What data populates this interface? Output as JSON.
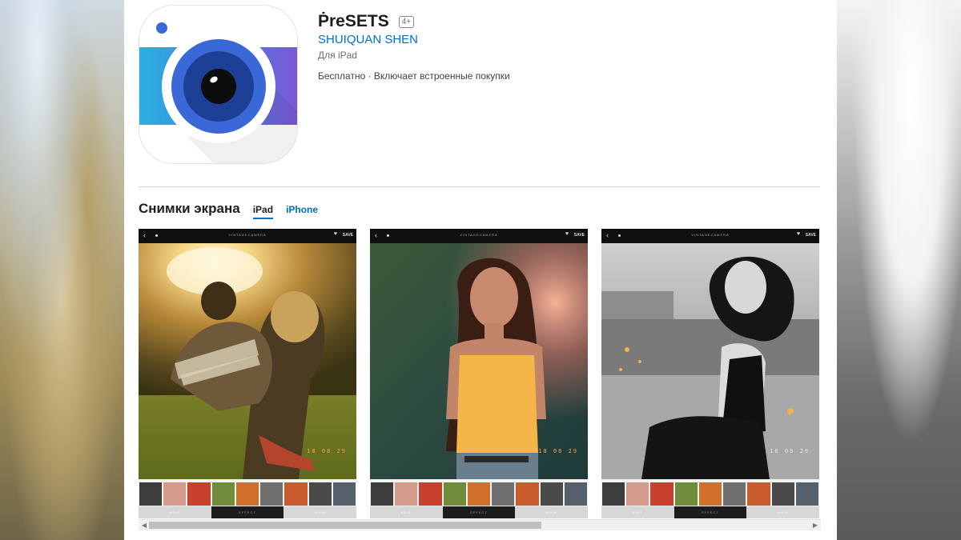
{
  "app": {
    "name": "ṖreSETS",
    "age_rating": "4+",
    "developer": "SHUIQUAN SHEN",
    "platform": "Для iPad",
    "price_line": "Бесплатно · Включает встроенные покупки"
  },
  "screenshots_section": {
    "title": "Снимки экрана",
    "tabs": [
      {
        "label": "iPad",
        "active": true
      },
      {
        "label": "iPhone",
        "active": false
      }
    ]
  },
  "screenshots": [
    {
      "back": "‹",
      "brand": "VINTAGECAMERA",
      "heart": "♥",
      "save": "SAVE",
      "date": "18 08 29",
      "bottom_tabs": [
        "EDIT",
        "EFFECT",
        "VIEW"
      ]
    },
    {
      "back": "‹",
      "brand": "VINTAGECAMERA",
      "heart": "♥",
      "save": "SAVE",
      "date": "18 08 29",
      "bottom_tabs": [
        "EDIT",
        "EFFECT",
        "VIEW"
      ]
    },
    {
      "back": "‹",
      "brand": "VINTAGECAMERA",
      "heart": "♥",
      "save": "SAVE",
      "date": "18 08 29",
      "bottom_tabs": [
        "EDIT",
        "EFFECT",
        "VIEW"
      ]
    }
  ],
  "scrollbar": {
    "left_arrow": "◀",
    "right_arrow": "▶"
  },
  "colors": {
    "link_blue": "#0070c9",
    "title_text": "#1d1d1f",
    "secondary_text": "#6e6e73",
    "icon_gradient_start": "#2bb0e0",
    "icon_gradient_end": "#7c57d6",
    "date_stamp": "#f6a34b"
  }
}
